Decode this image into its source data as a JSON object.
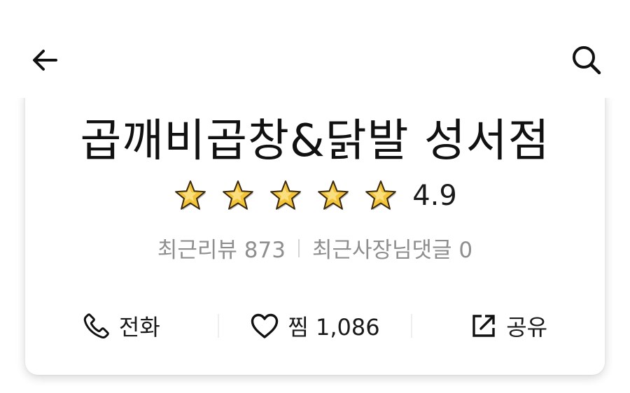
{
  "header": {
    "back_icon": "arrow-left-icon",
    "search_icon": "search-icon"
  },
  "store": {
    "name": "곱깨비곱창&닭발 성서점",
    "rating": {
      "value": "4.9",
      "stars_filled": 5,
      "stars_total": 5,
      "star_color": "#f3c338",
      "star_outline": "#3a2a10"
    },
    "reviews": {
      "recent_reviews": "최근리뷰 873",
      "recent_owner_comments": "최근사장님댓글 0"
    }
  },
  "actions": {
    "call": {
      "label": "전화",
      "icon": "phone-icon"
    },
    "like": {
      "label": "찜 1,086",
      "icon": "heart-icon"
    },
    "share": {
      "label": "공유",
      "icon": "share-icon"
    }
  }
}
